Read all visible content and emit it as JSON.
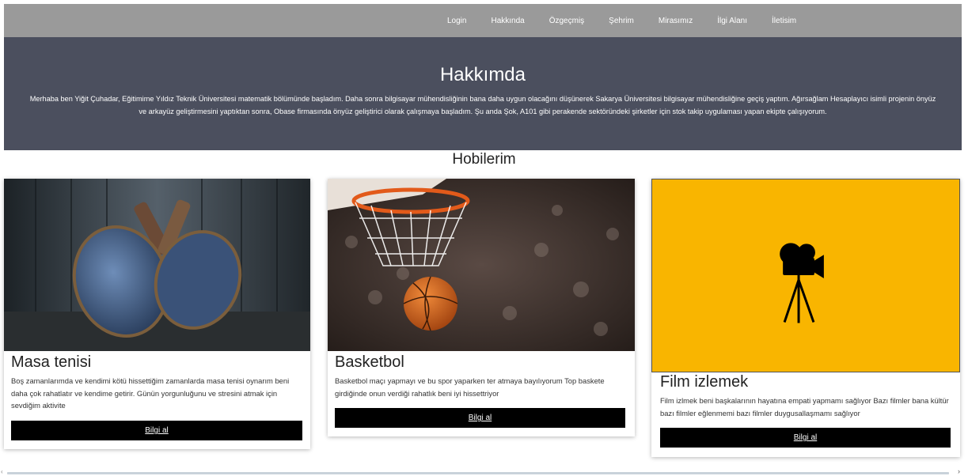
{
  "nav": {
    "items": [
      "Login",
      "Hakkında",
      "Özgeçmiş",
      "Şehrim",
      "Mirasımız",
      "İlgi Alanı",
      "İletisim"
    ]
  },
  "hero": {
    "title": "Hakkımda",
    "text": "Merhaba ben Yiğit Çuhadar, Eğitimime Yıldız Teknik Üniversitesi matematik bölümünde başladım. Daha sonra bilgisayar mühendisliğinin bana daha uygun olacağını düşünerek Sakarya Üniversitesi bilgisayar mühendisliğine geçiş yaptım. Ağırsağlam Hesaplayıcı isimli projenin önyüz ve arkayüz geliştirmesini yaptıktan sonra, Obase firmasında önyüz geliştirici olarak çalışmaya başladım. Şu anda Şok, A101 gibi perakende sektöründeki şirketler için stok takip uygulaması yapan ekipte çalışıyorum."
  },
  "section": {
    "title": "Hobilerim"
  },
  "cards": [
    {
      "title": "Masa tenisi",
      "desc": "Boş zamanlarımda ve kendimi kötü hissettiğim zamanlarda masa tenisi oynarım beni daha çok rahatlatır ve kendime getirir. Günün yorgunluğunu ve stresini atmak için sevdiğim aktivite",
      "button": "Bilgi al",
      "image_icon": "ping-pong-paddles-photo"
    },
    {
      "title": "Basketbol",
      "desc": "Basketbol maçı yapmayı ve bu spor yaparken ter atmaya bayılıyorum Top baskete girdiğinde onun verdiği rahatlık beni iyi hissettriyor",
      "button": "Bilgi al",
      "image_icon": "basketball-hoop-photo"
    },
    {
      "title": "Film izlemek",
      "desc": "Film izlmek beni başkalarının hayatına empati yapmamı sağlıyor Bazı filmler bana kültür bazı filmler eğlenmemi bazı filmler duygusallaşmamı sağlıyor",
      "button": "Bilgi al",
      "image_icon": "movie-camera-icon"
    }
  ],
  "colors": {
    "navbar": "#9a9a9a",
    "hero": "#4b4f5e",
    "film_bg": "#f9b500",
    "button": "#000000"
  }
}
